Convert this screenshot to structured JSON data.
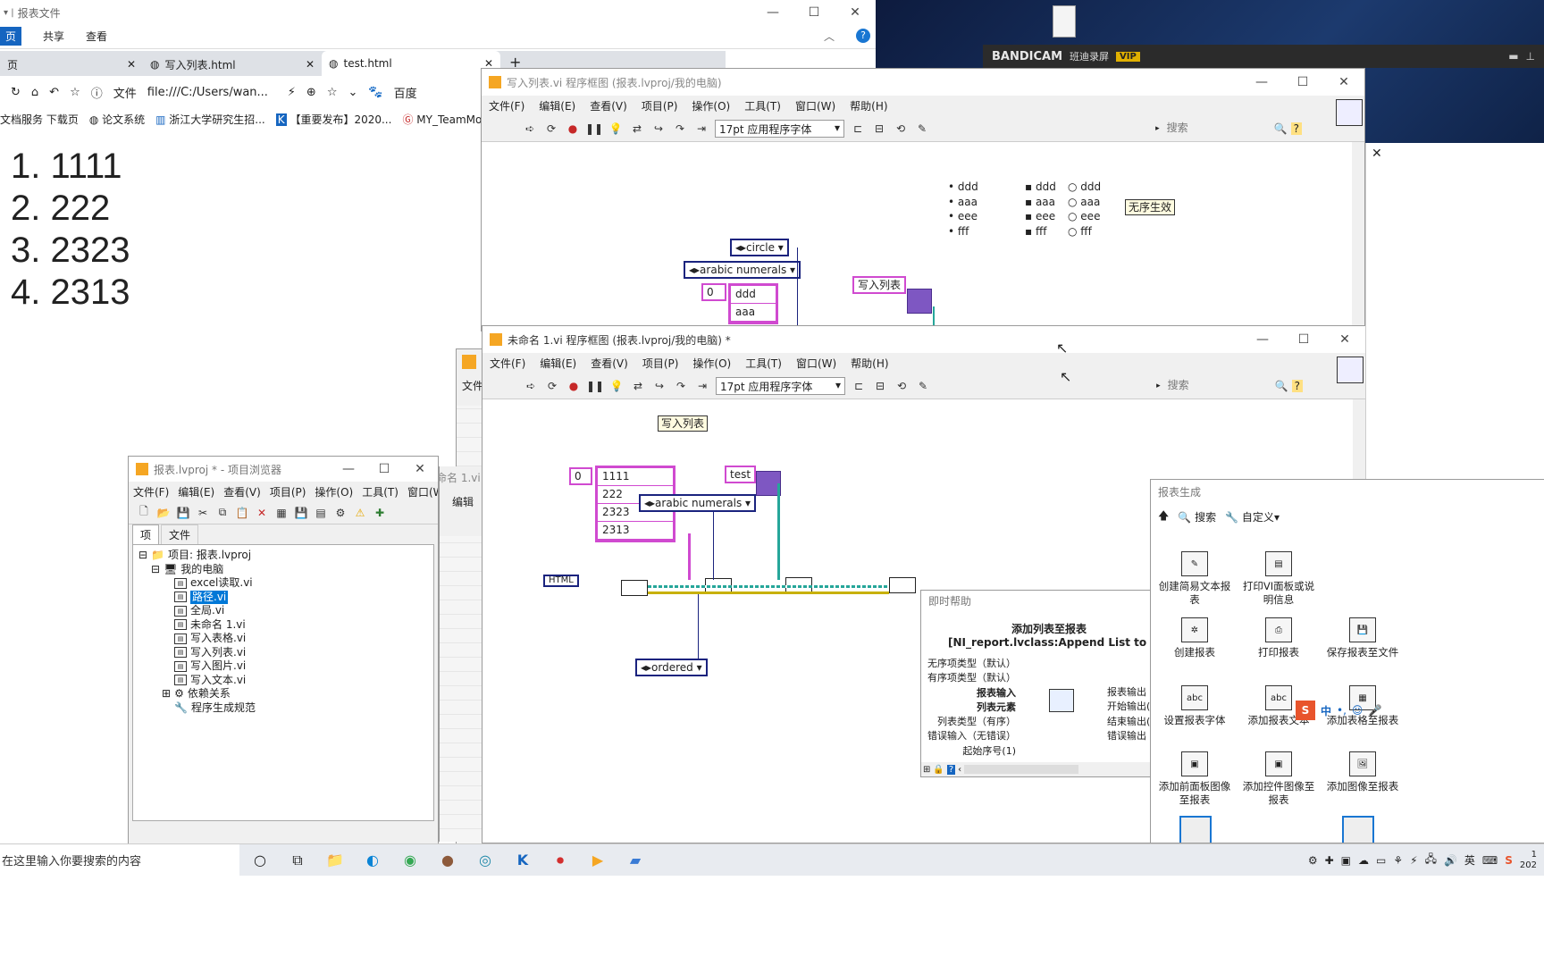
{
  "explorer": {
    "title": "报表文件",
    "menu": [
      "页",
      "共享",
      "查看"
    ]
  },
  "browser": {
    "tabs": [
      "页",
      "写入列表.html",
      "test.html"
    ],
    "url_prefix": "文件",
    "url": "file:///C:/Users/wan...",
    "search_engine": "百度",
    "bookmarks": [
      "文档服务 下载页",
      "论文系统",
      "浙江大学研究生招...",
      "【重要发布】2020...",
      "MY_TeamMon"
    ],
    "list": [
      "1. 1111",
      "2. 222",
      "3. 2323",
      "4. 2313"
    ]
  },
  "bandicam": {
    "brand": "BANDICAM",
    "sub": "班迪录屏",
    "vip": "VIP"
  },
  "lv_menu": [
    "文件(F)",
    "编辑(E)",
    "查看(V)",
    "项目(P)",
    "操作(O)",
    "工具(T)",
    "窗口(W)",
    "帮助(H)"
  ],
  "lv_font": "17pt 应用程序字体",
  "lv_search": "搜索",
  "vi1": {
    "title": "写入列表.vi 程序框图 (报表.lvproj/我的电脑)",
    "col1": [
      "ddd",
      "aaa",
      "eee",
      "fff"
    ],
    "col2": [
      "ddd",
      "aaa",
      "eee",
      "fff"
    ],
    "col3": [
      "ddd",
      "aaa",
      "eee",
      "fff"
    ],
    "note": "无序生效",
    "circle": "circle",
    "arabic": "arabic numerals",
    "index": "0",
    "arr": [
      "ddd",
      "aaa"
    ],
    "label": "写入列表"
  },
  "vi2": {
    "title": "未命名 1.vi 程序框图 (报表.lvproj/我的电脑) *",
    "label": "写入列表",
    "index": "0",
    "arr": [
      "1111",
      "222",
      "2323",
      "2313"
    ],
    "arabic": "arabic numerals",
    "test": "test",
    "ordered": "ordered",
    "html": "HTML"
  },
  "project": {
    "title": "报表.lvproj * - 项目浏览器",
    "menu": [
      "文件(F)",
      "编辑(E)",
      "查看(V)",
      "项目(P)",
      "操作(O)",
      "工具(T)",
      "窗口(W)"
    ],
    "tabs": [
      "项",
      "文件"
    ],
    "root": "项目: 报表.lvproj",
    "computer": "我的电脑",
    "items": [
      "excel读取.vi",
      "路径.vi",
      "全局.vi",
      "未命名 1.vi",
      "写入表格.vi",
      "写入列表.vi",
      "写入图片.vi",
      "写入文本.vi"
    ],
    "deps": "依赖关系",
    "build": "程序生成规范"
  },
  "bg_window": {
    "menu_snip": "文件",
    "edit_snip": "编辑",
    "name_snip": "命名 1.vi"
  },
  "help": {
    "title": "即时帮助",
    "fn_title": "添加列表至报表",
    "fn_sub": "[NI_report.lvclass:Append List to Report.vi",
    "left": [
      "无序项类型（默认）",
      "有序项类型（默认）",
      "报表输入",
      "列表元素",
      "列表类型（有序）",
      "错误输入（无错误）",
      "起始序号(1)"
    ],
    "right": [
      "报表输出",
      "开始输出(",
      "结束输出(",
      "错误输出"
    ]
  },
  "palette": {
    "title": "报表生成",
    "search": "搜索",
    "custom": "自定义",
    "items": [
      "创建简易文本报表",
      "打印VI面板或说明信息",
      "创建报表",
      "打印报表",
      "保存报表至文件",
      "设置报表字体",
      "添加报表文本",
      "添加表格至报表",
      "添加前面板图像至报表",
      "添加控件图像至报表",
      "添加图像至报表"
    ]
  },
  "ime": [
    "中",
    "•,",
    "☺",
    "🎤"
  ],
  "taskbar": {
    "search": "在这里输入你要搜索的内容",
    "clock": "1",
    "year": "202"
  }
}
